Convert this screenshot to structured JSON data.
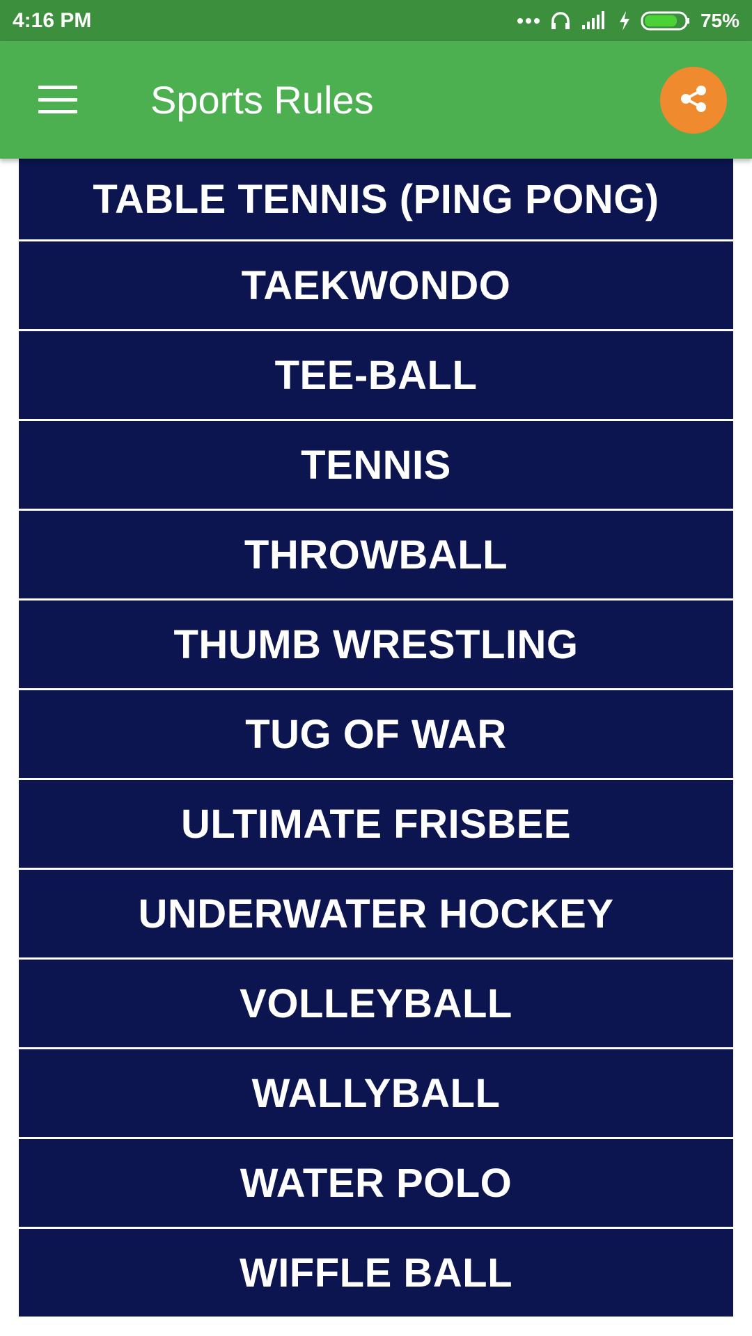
{
  "status_bar": {
    "time": "4:16 PM",
    "battery": "75%",
    "icons": [
      "more-dots-icon",
      "headphones-icon",
      "signal-icon",
      "charging-icon",
      "battery-icon"
    ]
  },
  "app_bar": {
    "title": "Sports Rules",
    "menu_icon": "hamburger-menu-icon",
    "share_icon": "share-icon",
    "background_color": "#4caf50",
    "share_button_color": "#f08a2e"
  },
  "list": {
    "item_background": "#0c154f",
    "items": [
      {
        "label": "TABLE TENNIS (PING PONG)"
      },
      {
        "label": "TAEKWONDO"
      },
      {
        "label": "TEE-BALL"
      },
      {
        "label": "TENNIS"
      },
      {
        "label": "THROWBALL"
      },
      {
        "label": "THUMB WRESTLING"
      },
      {
        "label": "TUG OF WAR"
      },
      {
        "label": "ULTIMATE FRISBEE"
      },
      {
        "label": "UNDERWATER HOCKEY"
      },
      {
        "label": "VOLLEYBALL"
      },
      {
        "label": "WALLYBALL"
      },
      {
        "label": "WATER POLO"
      },
      {
        "label": "WIFFLE BALL"
      }
    ]
  }
}
